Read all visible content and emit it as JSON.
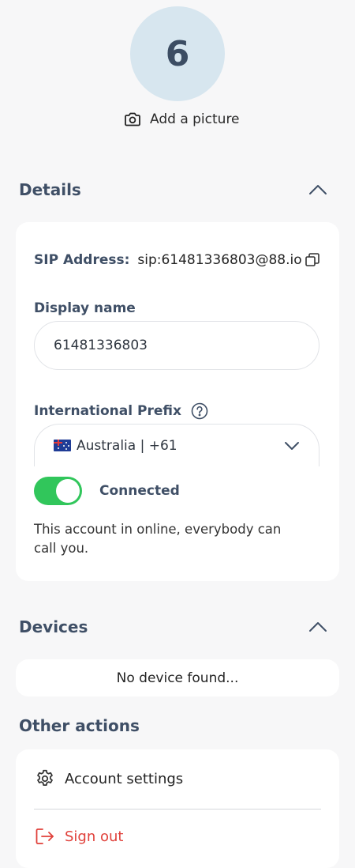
{
  "profile": {
    "avatar_initial": "6",
    "add_picture_label": "Add a picture"
  },
  "details": {
    "title": "Details",
    "sip_label": "SIP Address:",
    "sip_value": "sip:61481336803@88.io",
    "display_name_label": "Display name",
    "display_name_value": "61481336803",
    "prefix_label": "International Prefix",
    "prefix_value": "Australia | +61",
    "toggle_label": "Connected",
    "toggle_on": true,
    "status_text": "This account in online, everybody can call you."
  },
  "devices": {
    "title": "Devices",
    "empty_text": "No device found..."
  },
  "other_actions": {
    "title": "Other actions",
    "account_settings_label": "Account settings",
    "sign_out_label": "Sign out"
  },
  "colors": {
    "accent_green": "#31c65b",
    "heading": "#3f4f66",
    "danger": "#e0403a",
    "avatar_bg": "#d7e6ef"
  }
}
